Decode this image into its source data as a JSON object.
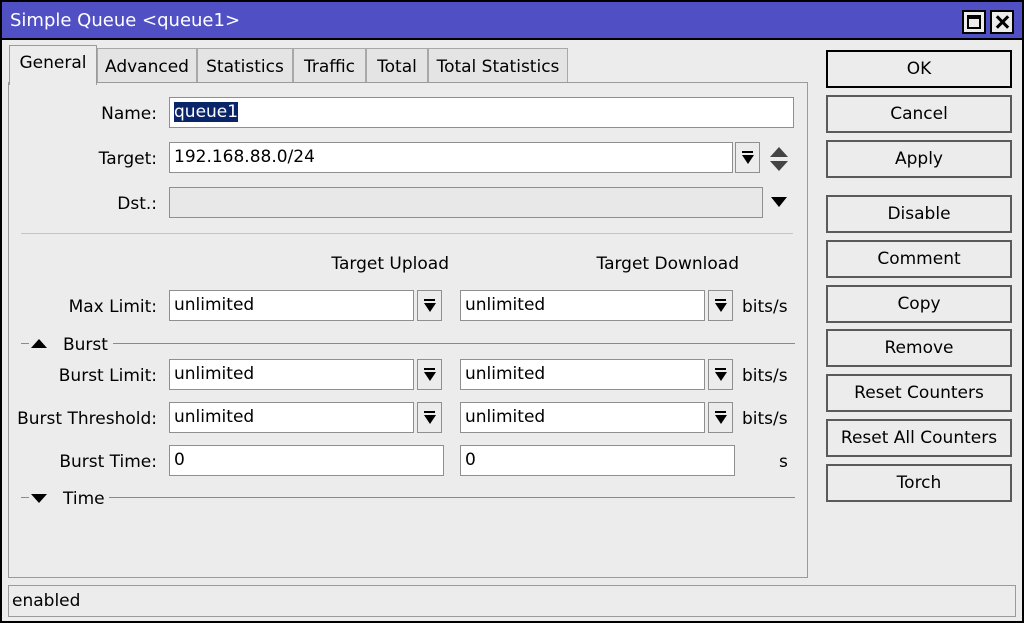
{
  "window": {
    "title": "Simple Queue <queue1>"
  },
  "tabs": [
    {
      "label": "General"
    },
    {
      "label": "Advanced"
    },
    {
      "label": "Statistics"
    },
    {
      "label": "Traffic"
    },
    {
      "label": "Total"
    },
    {
      "label": "Total Statistics"
    }
  ],
  "general": {
    "name_label": "Name:",
    "name_value": "queue1",
    "target_label": "Target:",
    "target_value": "192.168.88.0/24",
    "dst_label": "Dst.:",
    "dst_value": "",
    "col_upload": "Target Upload",
    "col_download": "Target Download",
    "max_limit_label": "Max Limit:",
    "max_limit_upload": "unlimited",
    "max_limit_download": "unlimited",
    "unit_bits": "bits/s",
    "burst_section": "Burst",
    "burst_limit_label": "Burst Limit:",
    "burst_limit_upload": "unlimited",
    "burst_limit_download": "unlimited",
    "burst_threshold_label": "Burst Threshold:",
    "burst_threshold_upload": "unlimited",
    "burst_threshold_download": "unlimited",
    "burst_time_label": "Burst Time:",
    "burst_time_upload": "0",
    "burst_time_download": "0",
    "unit_seconds": "s",
    "time_section": "Time"
  },
  "buttons": {
    "ok": "OK",
    "cancel": "Cancel",
    "apply": "Apply",
    "disable": "Disable",
    "comment": "Comment",
    "copy": "Copy",
    "remove": "Remove",
    "reset_counters": "Reset Counters",
    "reset_all_counters": "Reset All Counters",
    "torch": "Torch"
  },
  "status": {
    "text": "enabled"
  },
  "icons": {
    "maximize": "maximize-icon",
    "close": "close-icon",
    "dropdown": "dropdown-icon",
    "updown": "up-down-icon",
    "collapse": "collapse-icon",
    "expand": "expand-icon"
  },
  "colors": {
    "titlebar": "#5050c4",
    "selection": "#0a246a",
    "window_bg": "#ececec"
  }
}
